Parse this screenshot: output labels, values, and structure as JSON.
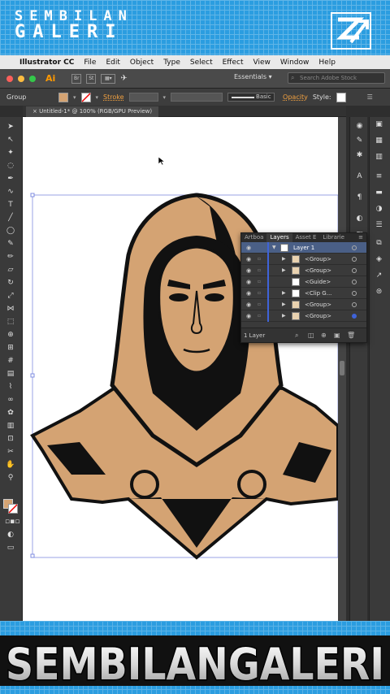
{
  "banner": {
    "line1": "SEMBILAN",
    "line2": "GALERI",
    "footer_text": "SEMBILANGALERI"
  },
  "menubar": {
    "app_name": "Illustrator CC",
    "items": [
      "File",
      "Edit",
      "Object",
      "Type",
      "Select",
      "Effect",
      "View",
      "Window",
      "Help"
    ]
  },
  "appbar": {
    "app_icon": "Ai",
    "buttons": [
      "Br",
      "St"
    ],
    "workspace": "Essentials",
    "search_placeholder": "Search Adobe Stock"
  },
  "control": {
    "selection": "Group",
    "stroke_label": "Stroke",
    "brush_label": "Basic",
    "opacity_label": "Opacity",
    "style_label": "Style:"
  },
  "document": {
    "tab_title": "Untitled-1* @ 100% (RGB/GPU Preview)"
  },
  "layers_panel": {
    "tabs": [
      "Artboa",
      "Layers",
      "Asset E",
      "Librarie"
    ],
    "active_tab": "Layers",
    "layer_name": "Layer 1",
    "sublayers": [
      "<Group>",
      "<Group>",
      "<Guide>",
      "<Clip G...",
      "<Group>",
      "<Group>"
    ],
    "footer_count": "1 Layer"
  },
  "colors": {
    "brand_blue": "#2b9de0",
    "skin": "#d4a373",
    "outline": "#111111",
    "selection": "#3f63d8"
  },
  "icons": {
    "apple": "apple-icon",
    "search": "search-icon",
    "eye": "eye-icon",
    "lock": "lock-icon"
  }
}
